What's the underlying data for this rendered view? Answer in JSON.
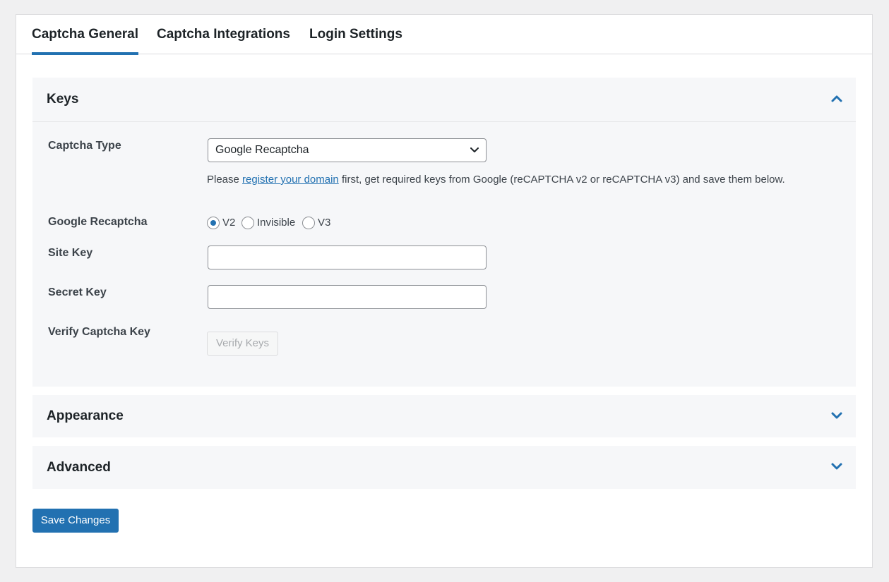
{
  "tabs": [
    {
      "label": "Captcha General",
      "active": true
    },
    {
      "label": "Captcha Integrations",
      "active": false
    },
    {
      "label": "Login Settings",
      "active": false
    }
  ],
  "sections": {
    "keys": {
      "title": "Keys",
      "expanded": true,
      "captcha_type_label": "Captcha Type",
      "captcha_type_value": "Google Recaptcha",
      "help_before": "Please ",
      "help_link": "register your domain",
      "help_after": " first, get required keys from Google (reCAPTCHA v2 or reCAPTCHA v3) and save them below.",
      "recaptcha_label": "Google Recaptcha",
      "recaptcha_options": [
        {
          "label": "V2",
          "checked": true
        },
        {
          "label": "Invisible",
          "checked": false
        },
        {
          "label": "V3",
          "checked": false
        }
      ],
      "site_key_label": "Site Key",
      "site_key_value": "",
      "secret_key_label": "Secret Key",
      "secret_key_value": "",
      "verify_label": "Verify Captcha Key",
      "verify_button": "Verify Keys"
    },
    "appearance": {
      "title": "Appearance",
      "expanded": false
    },
    "advanced": {
      "title": "Advanced",
      "expanded": false
    }
  },
  "save_button": "Save Changes",
  "colors": {
    "accent": "#2271b1",
    "page_bg": "#f0f0f1",
    "section_bg": "#f6f7f9"
  },
  "icons": {
    "keys_toggle": "chevron-up-icon",
    "appearance_toggle": "chevron-down-icon",
    "advanced_toggle": "chevron-down-icon",
    "select_toggle": "chevron-down-icon"
  }
}
